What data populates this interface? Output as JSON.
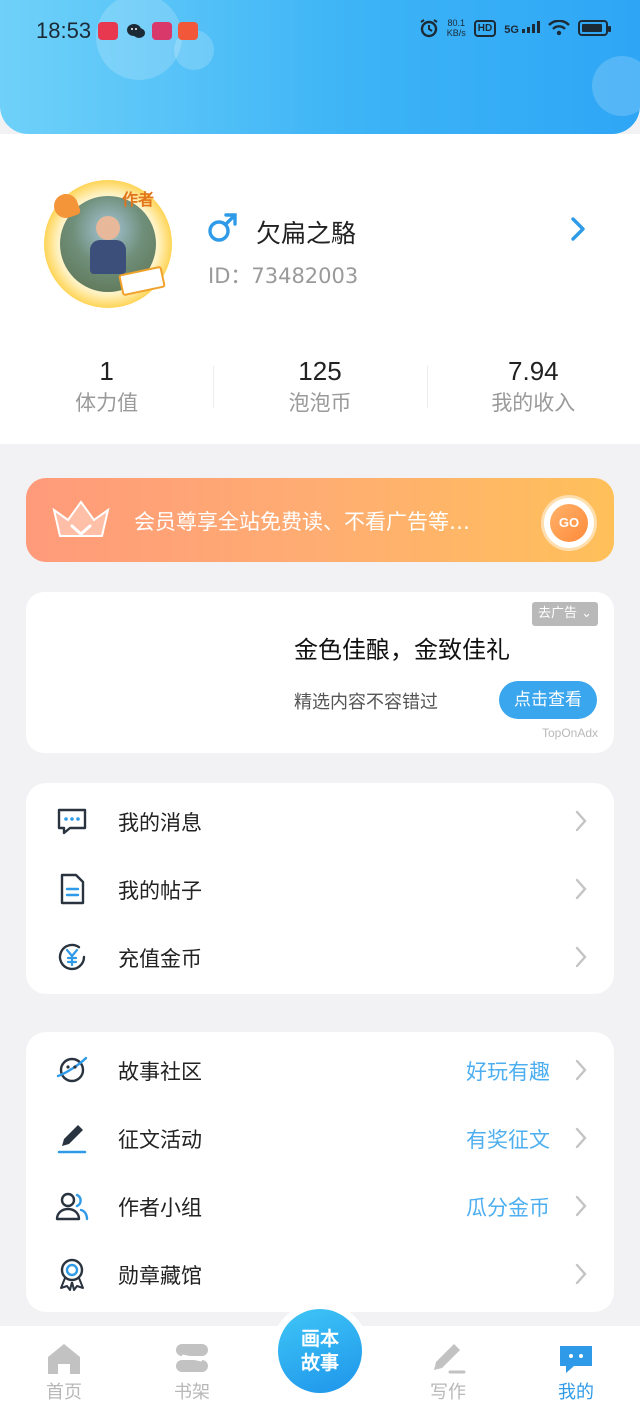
{
  "status_bar": {
    "time": "18:53",
    "net_speed_value": "80.1",
    "net_speed_unit": "KB/s",
    "hd_label": "HD",
    "signal_label": "5G"
  },
  "profile": {
    "author_badge": "作者",
    "nickname": "欠扁之駱",
    "user_id": "ID：73482003",
    "stats": [
      {
        "value": "1",
        "label": "体力值"
      },
      {
        "value": "125",
        "label": "泡泡币"
      },
      {
        "value": "7.94",
        "label": "我的收入"
      }
    ]
  },
  "vip_banner": {
    "text": "会员尊享全站免费读、不看广告等…",
    "go_label": "GO"
  },
  "ad": {
    "tag": "去广告",
    "title": "金色佳酿，金致佳礼",
    "subtitle": "精选内容不容错过",
    "button": "点击查看",
    "source": "TopOnAdx"
  },
  "menu_group_1": [
    {
      "label": "我的消息",
      "icon": "message-icon"
    },
    {
      "label": "我的帖子",
      "icon": "document-icon"
    },
    {
      "label": "充值金币",
      "icon": "yuan-coin-icon"
    }
  ],
  "menu_group_2": [
    {
      "label": "故事社区",
      "hint": "好玩有趣",
      "icon": "planet-icon"
    },
    {
      "label": "征文活动",
      "hint": "有奖征文",
      "icon": "pen-icon"
    },
    {
      "label": "作者小组",
      "hint": "瓜分金币",
      "icon": "group-icon"
    },
    {
      "label": "勋章藏馆",
      "hint": "",
      "icon": "medal-icon"
    }
  ],
  "bottom_nav": {
    "items": [
      {
        "label": "首页",
        "icon": "home-icon"
      },
      {
        "label": "书架",
        "icon": "bookshelf-icon"
      },
      {
        "label": "写作",
        "icon": "write-icon"
      },
      {
        "label": "我的",
        "icon": "me-chat-icon"
      }
    ],
    "center_line1": "画本",
    "center_line2": "故事",
    "active": "我的"
  },
  "colors": {
    "accent": "#2f9be8",
    "hint_blue": "#4eaff0",
    "vip_gradient_start": "#ff9a7a",
    "vip_gradient_end": "#ffc05a"
  }
}
